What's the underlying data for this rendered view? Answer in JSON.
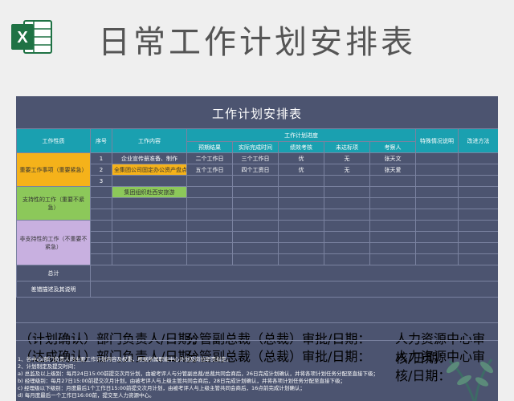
{
  "page": {
    "big_title": "日常工作计划安排表"
  },
  "sheet": {
    "title": "工作计划安排表",
    "headers": {
      "type": "工作性质",
      "seq": "序号",
      "content": "工作内容",
      "progress": "工作计划进度",
      "special": "特殊情况说明",
      "improve": "改进方法",
      "sub": [
        "预期结果",
        "实际完成时间",
        "绩效考核",
        "未达标项",
        "考察人"
      ]
    },
    "categories": {
      "important_urgent": "重要工作事项（重要紧急）",
      "support_nonurgent": "支持性的工作（重要不紧急）",
      "non_support": "非支持性的工作（不重要不紧急）"
    },
    "rows": [
      {
        "seq": "1",
        "content": "企业宣传册准备、制作",
        "expected": "二个工作日",
        "actual": "三个工作日",
        "perf": "优",
        "unmet": "无",
        "inspector": "张天文"
      },
      {
        "seq": "2",
        "content": "全集团公司固定办公资产盘点",
        "expected": "五个工作日",
        "actual": "四个工资日",
        "perf": "优",
        "unmet": "无",
        "inspector": "张天爱"
      },
      {
        "seq": "3",
        "content": "",
        "expected": "",
        "actual": "",
        "perf": "",
        "unmet": "",
        "inspector": ""
      },
      {
        "seq": "",
        "content": "集团组织赴西安旅游",
        "expected": "",
        "actual": "",
        "perf": "",
        "unmet": "",
        "inspector": ""
      }
    ],
    "total_label": "总计",
    "deviation_label": "差错描述及其说明",
    "sign1": {
      "left": "（计划确认）部门负责人/日期：",
      "mid": "分管副总裁（总裁）审批/日期：",
      "right": "人力资源中心审核/日期："
    },
    "sign2": {
      "left": "（达成确认）部门负责人/日期：",
      "mid": "分管副总裁（总裁）审批/日期：",
      "right": "人力资源中心审核/日期："
    },
    "notes": [
      "1、各中心/部门负责人的主要工作计划内容及权重，根据所属职能中心计划及岗位职责拟定。",
      "2、计划制定及提交时间：",
      "   a) 总监及以上级别：每月24日15:00前提交次月计划，由被考评人与分管副总裁/总裁共同会商后，26日完成计划确认，并将各项计划任务分配至直接下级；",
      "   b) 经理级别：每月27日15:00前提交次月计划，由被考评人与上级主管共同会商后，28日完成计划确认，并将各项计划任务分配至直接下级；",
      "   c) 经理级以下级别：月度最后1个工作日15:00前提交次月计划，由被考评人与上级主管共同会商后，16点前完成计划确认；",
      "   d) 每月度最后一个工作日16:00前，提交至人力资源中心。"
    ]
  }
}
